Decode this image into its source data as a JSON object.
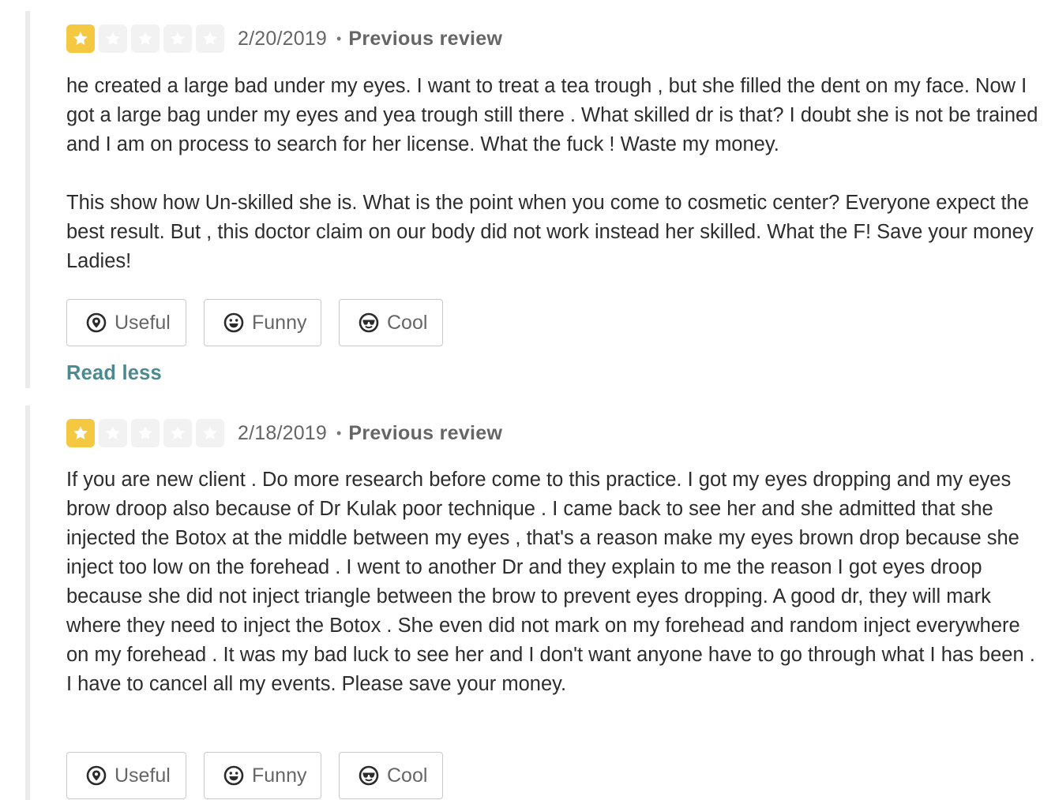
{
  "reviews": [
    {
      "rating": 1,
      "max_rating": 5,
      "date": "2/20/2019",
      "separator": "•",
      "previous_label": "Previous review",
      "text": "he created a large bad under my eyes. I want to treat a tea trough , but she filled the dent on my face. Now I got a large bag under my eyes and yea trough still there . What skilled dr is that? I doubt she is not be trained and I am on process to search for her license. What the fuck ! Waste my money.\n\nThis show how Un-skilled she is. What is the point when you come to cosmetic center? Everyone expect the best result. But , this doctor claim on our body did not work instead her skilled. What the F! Save your money Ladies!",
      "buttons": {
        "useful": "Useful",
        "funny": "Funny",
        "cool": "Cool"
      },
      "read_less": "Read less"
    },
    {
      "rating": 1,
      "max_rating": 5,
      "date": "2/18/2019",
      "separator": "•",
      "previous_label": "Previous review",
      "text": "If you are new client . Do more research before come to this practice.  I got my eyes dropping and my eyes brow droop also because of Dr Kulak poor technique . I came back to see her and she admitted that she injected the Botox at the middle between my eyes , that's a reason make my eyes brown drop because she inject too low on the  forehead . I went to another Dr and they explain to me the reason I got eyes droop because she did not inject triangle between the brow to prevent eyes dropping. A good dr, they will mark where they need to inject the Botox . She even did not mark on my forehead and random inject everywhere on my forehead .  It was my bad luck to see her and I don't want anyone have to go through what I has been . I have to cancel all my events. Please save your money.",
      "buttons": {
        "useful": "Useful",
        "funny": "Funny",
        "cool": "Cool"
      }
    }
  ],
  "colors": {
    "star_filled": "#f5c842",
    "star_empty": "#f2f2f2",
    "link_teal": "#4d8a8f"
  },
  "icons": {
    "star": "star-icon",
    "useful": "useful-icon",
    "funny": "funny-icon",
    "cool": "cool-icon"
  }
}
